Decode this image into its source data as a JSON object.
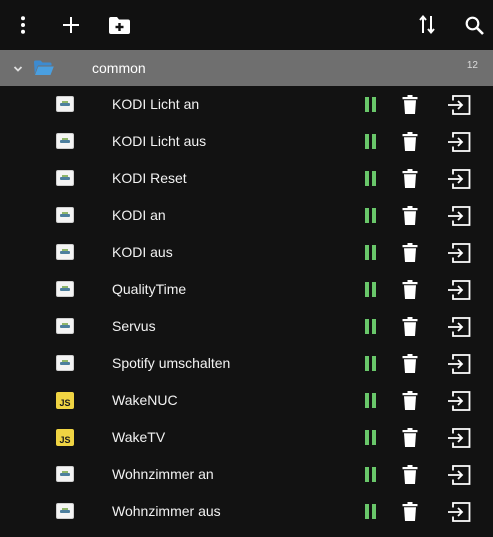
{
  "toolbar": {
    "menu_icon": "more-vertical-icon",
    "add_icon": "plus-icon",
    "new_folder_icon": "folder-plus-icon",
    "sort_icon": "sort-arrows-icon",
    "search_icon": "search-icon"
  },
  "folder": {
    "name": "common",
    "count": "12",
    "icon": "folder-open-icon",
    "toggle_icon": "chevron-down-icon"
  },
  "colors": {
    "folder_icon": "#4a9fe0",
    "running_indicator": "#69c76a",
    "js_badge": "#f0d443"
  },
  "scripts": [
    {
      "name": "KODI Licht an",
      "type": "blockly"
    },
    {
      "name": "KODI Licht aus",
      "type": "blockly"
    },
    {
      "name": "KODI Reset",
      "type": "blockly"
    },
    {
      "name": "KODI an",
      "type": "blockly"
    },
    {
      "name": "KODI aus",
      "type": "blockly"
    },
    {
      "name": "QualityTime",
      "type": "blockly"
    },
    {
      "name": "Servus",
      "type": "blockly"
    },
    {
      "name": "Spotify umschalten",
      "type": "blockly"
    },
    {
      "name": "WakeNUC",
      "type": "js",
      "badge": "JS"
    },
    {
      "name": "WakeTV",
      "type": "js",
      "badge": "JS"
    },
    {
      "name": "Wohnzimmer an",
      "type": "blockly"
    },
    {
      "name": "Wohnzimmer aus",
      "type": "blockly"
    }
  ]
}
